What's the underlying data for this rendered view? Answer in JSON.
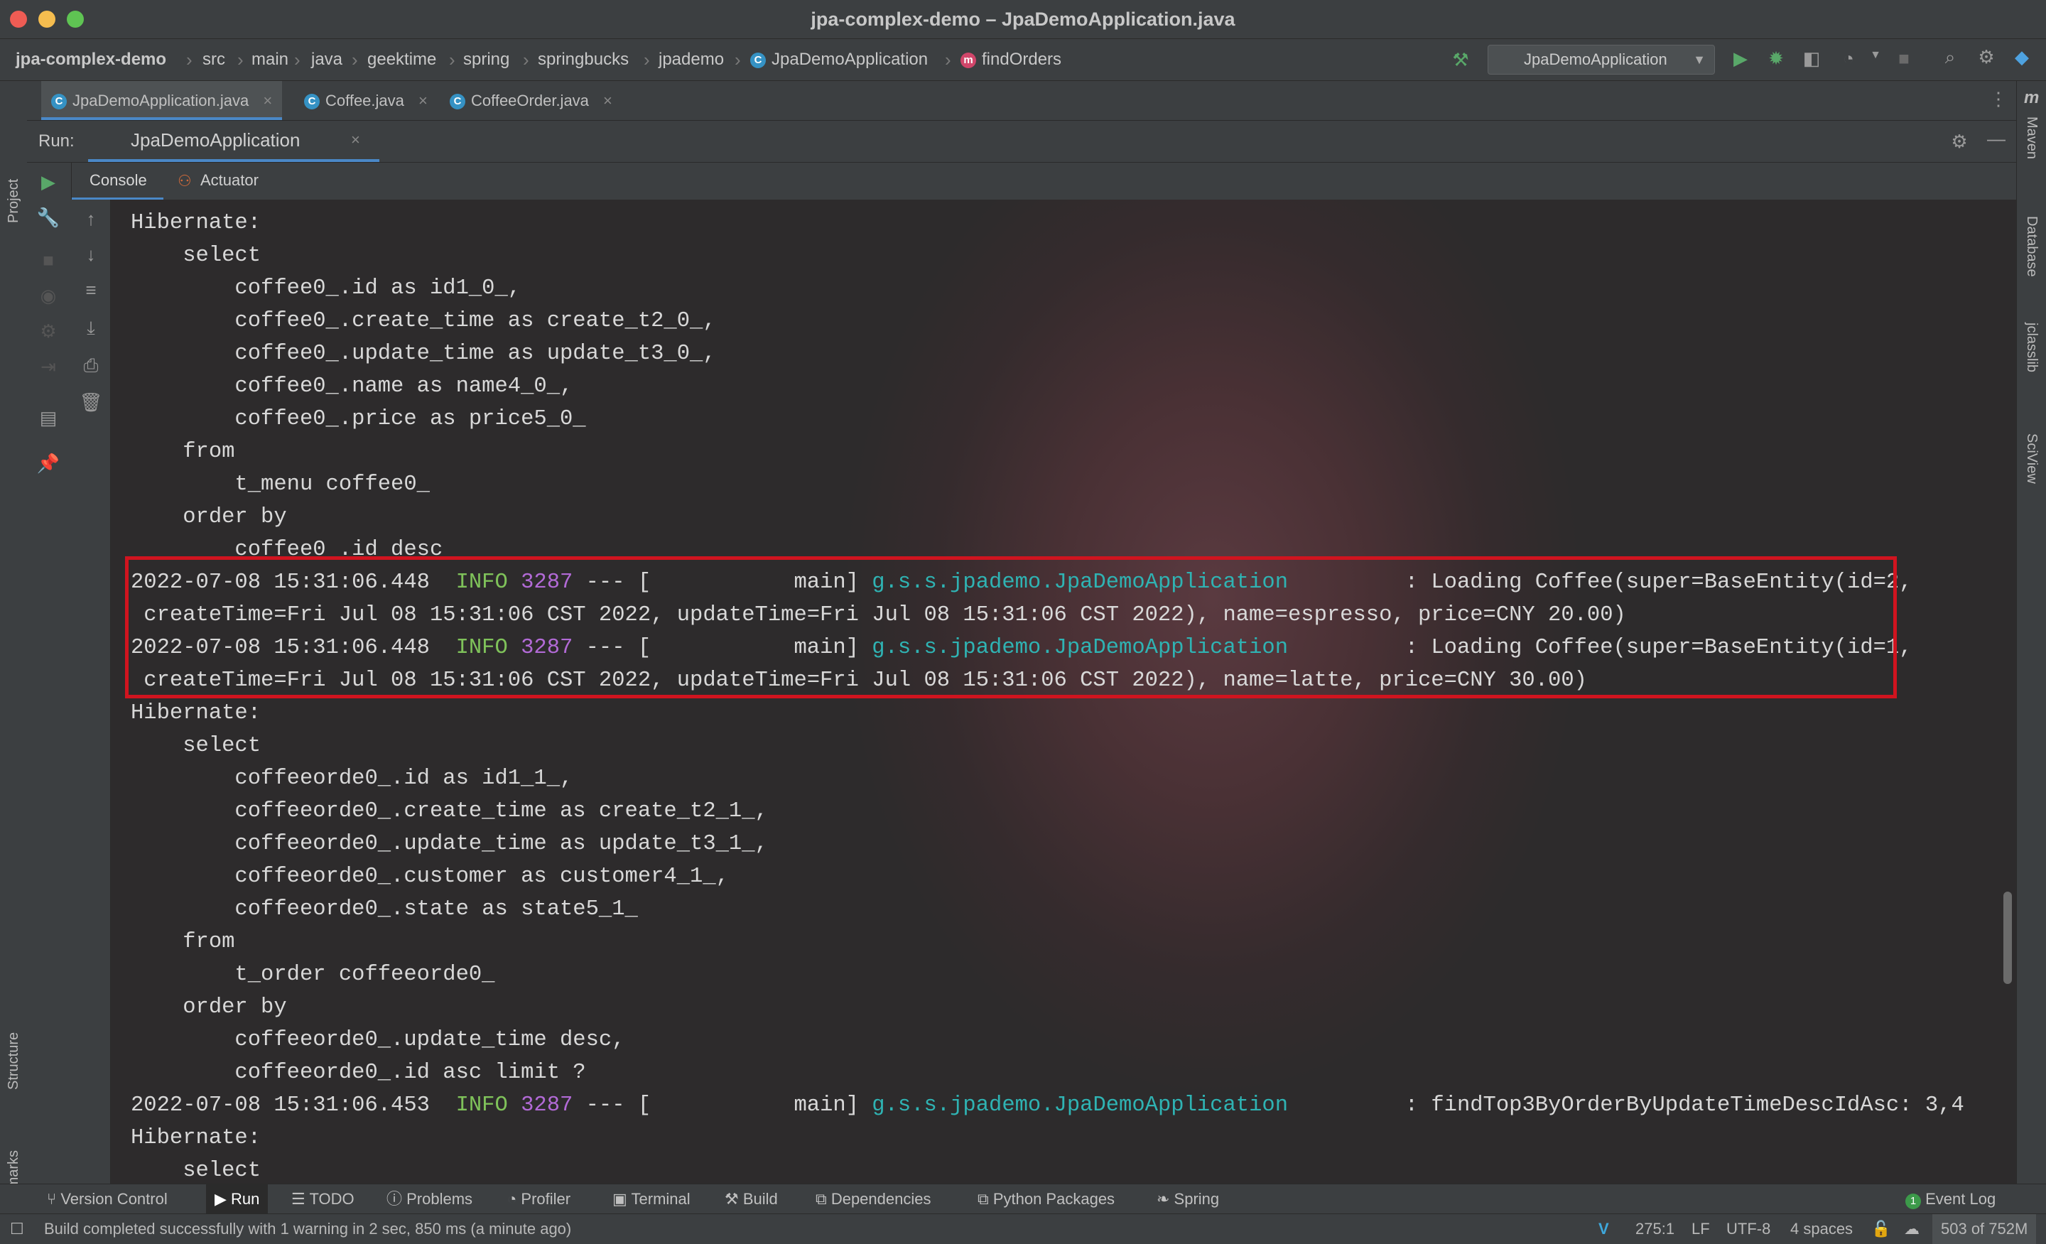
{
  "window": {
    "title": "jpa-complex-demo – JpaDemoApplication.java"
  },
  "breadcrumb": [
    "jpa-complex-demo",
    "src",
    "main",
    "java",
    "geektime",
    "spring",
    "springbucks",
    "jpademo",
    "JpaDemoApplication",
    "findOrders"
  ],
  "run_config": {
    "label": "JpaDemoApplication"
  },
  "editor_tabs": [
    {
      "label": "JpaDemoApplication.java"
    },
    {
      "label": "Coffee.java"
    },
    {
      "label": "CoffeeOrder.java"
    }
  ],
  "run_panel": {
    "run_label": "Run:",
    "tab_label": "JpaDemoApplication",
    "subtabs": [
      "Console",
      "Actuator"
    ]
  },
  "left_strip": {
    "project": "Project",
    "structure": "Structure",
    "bookmarks": "Bookmarks"
  },
  "right_strip": {
    "maven_icon": "m",
    "maven": "Maven",
    "database": "Database",
    "jclasslib": "jclasslib",
    "sciview": "SciView"
  },
  "console": {
    "lines": [
      {
        "text": "Hibernate: "
      },
      {
        "text": "    select"
      },
      {
        "text": "        coffee0_.id as id1_0_,"
      },
      {
        "text": "        coffee0_.create_time as create_t2_0_,"
      },
      {
        "text": "        coffee0_.update_time as update_t3_0_,"
      },
      {
        "text": "        coffee0_.name as name4_0_,"
      },
      {
        "text": "        coffee0_.price as price5_0_ "
      },
      {
        "text": "    from"
      },
      {
        "text": "        t_menu coffee0_ "
      },
      {
        "text": "    order by"
      },
      {
        "text": "        coffee0_.id desc"
      },
      {
        "log": true,
        "ts": "2022-07-08 15:31:06.448",
        "level": "INFO",
        "pid": "3287",
        "sep": " --- [           main] ",
        "cls": "g.s.s.jpademo.JpaDemoApplication",
        "msg": "         : Loading Coffee(super=BaseEntity(id=2,"
      },
      {
        "text": " createTime=Fri Jul 08 15:31:06 CST 2022, updateTime=Fri Jul 08 15:31:06 CST 2022), name=espresso, price=CNY 20.00)"
      },
      {
        "log": true,
        "ts": "2022-07-08 15:31:06.448",
        "level": "INFO",
        "pid": "3287",
        "sep": " --- [           main] ",
        "cls": "g.s.s.jpademo.JpaDemoApplication",
        "msg": "         : Loading Coffee(super=BaseEntity(id=1,"
      },
      {
        "text": " createTime=Fri Jul 08 15:31:06 CST 2022, updateTime=Fri Jul 08 15:31:06 CST 2022), name=latte, price=CNY 30.00)"
      },
      {
        "text": "Hibernate: "
      },
      {
        "text": "    select"
      },
      {
        "text": "        coffeeorde0_.id as id1_1_,"
      },
      {
        "text": "        coffeeorde0_.create_time as create_t2_1_,"
      },
      {
        "text": "        coffeeorde0_.update_time as update_t3_1_,"
      },
      {
        "text": "        coffeeorde0_.customer as customer4_1_,"
      },
      {
        "text": "        coffeeorde0_.state as state5_1_ "
      },
      {
        "text": "    from"
      },
      {
        "text": "        t_order coffeeorde0_ "
      },
      {
        "text": "    order by"
      },
      {
        "text": "        coffeeorde0_.update_time desc,"
      },
      {
        "text": "        coffeeorde0_.id asc limit ?"
      },
      {
        "log": true,
        "ts": "2022-07-08 15:31:06.453",
        "level": "INFO",
        "pid": "3287",
        "sep": " --- [           main] ",
        "cls": "g.s.s.jpademo.JpaDemoApplication",
        "msg": "         : findTop3ByOrderByUpdateTimeDescIdAsc: 3,4"
      },
      {
        "text": "Hibernate: "
      },
      {
        "text": "    select"
      }
    ]
  },
  "bottom_tools": [
    "Version Control",
    "Run",
    "TODO",
    "Problems",
    "Profiler",
    "Terminal",
    "Build",
    "Dependencies",
    "Python Packages",
    "Spring"
  ],
  "event_log": {
    "count": "1",
    "label": "Event Log"
  },
  "status": {
    "message": "Build completed successfully with 1 warning in 2 sec, 850 ms (a minute ago)",
    "position": "275:1",
    "line_sep": "LF",
    "encoding": "UTF-8",
    "indent": "4 spaces",
    "memory": "503 of 752M"
  },
  "colors": {
    "highlight_border": "#d0141f",
    "info": "#7fc25a",
    "pid": "#b26ad6",
    "class": "#2fb3b3"
  }
}
